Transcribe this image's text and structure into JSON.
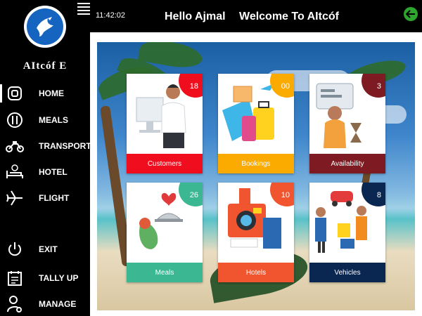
{
  "sidebar": {
    "brand": "AItcóf E",
    "items": [
      {
        "label": "HOME",
        "icon": "home-icon",
        "active": true
      },
      {
        "label": "MEALS",
        "icon": "meals-icon",
        "active": false
      },
      {
        "label": "TRANSPORT",
        "icon": "motorbike-icon",
        "active": false
      },
      {
        "label": "HOTEL",
        "icon": "bed-icon",
        "active": false
      },
      {
        "label": "FLIGHT",
        "icon": "airplane-icon",
        "active": false
      },
      {
        "label": "EXIT",
        "icon": "power-icon",
        "active": false
      },
      {
        "label": "TALLY UP",
        "icon": "calendar-list-icon",
        "active": false
      },
      {
        "label": "MANAGE",
        "icon": "user-gear-icon",
        "active": false
      }
    ]
  },
  "header": {
    "time": "11:42:02",
    "greeting": "Hello Ajmal",
    "welcome": "Welcome To  AItcóf"
  },
  "cards": [
    {
      "label": "Customers",
      "count": "18",
      "color": "#f00d1e"
    },
    {
      "label": "Bookings",
      "count": "00",
      "color": "#fbaa00"
    },
    {
      "label": "Availability",
      "count": "3",
      "color": "#7e1b22"
    },
    {
      "label": "Meals",
      "count": "26",
      "color": "#3bb792"
    },
    {
      "label": "Hotels",
      "count": "10",
      "color": "#f0552f"
    },
    {
      "label": "Vehicles",
      "count": "8",
      "color": "#0a2752"
    }
  ],
  "colors": {
    "back_button": "#2ea52e",
    "logo_blue": "#1565c0"
  }
}
